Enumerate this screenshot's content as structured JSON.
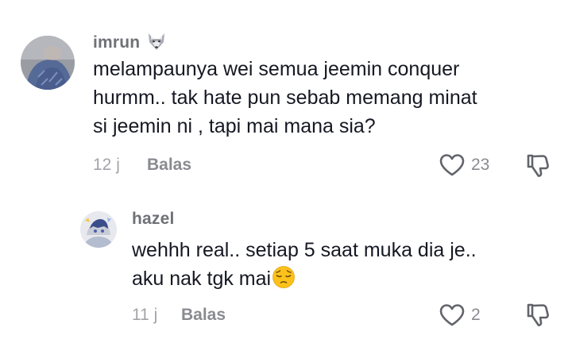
{
  "comments": [
    {
      "username": "imrun",
      "username_emoji": "wolf-face",
      "text_lines": [
        "melampaunya wei semua jeemin conquer",
        "hurmm.. tak hate pun sebab memang minat",
        "si jeemin ni , tapi mai mana sia?"
      ],
      "time": "12 j",
      "reply_label": "Balas",
      "like_count": "23"
    },
    {
      "username": "hazel",
      "text_lines": [
        "wehhh real.. setiap 5 saat muka dia je..",
        "aku nak tgk mai"
      ],
      "text_emoji": "pensive-face",
      "time": "11 j",
      "reply_label": "Balas",
      "like_count": "2"
    }
  ],
  "icons": {
    "like": "heart-outline-icon",
    "dislike": "thumbs-down-outline-icon"
  },
  "colors": {
    "text": "#161823",
    "username": "#6f7177",
    "meta": "#a3a4a8",
    "action": "#8a8b91"
  }
}
